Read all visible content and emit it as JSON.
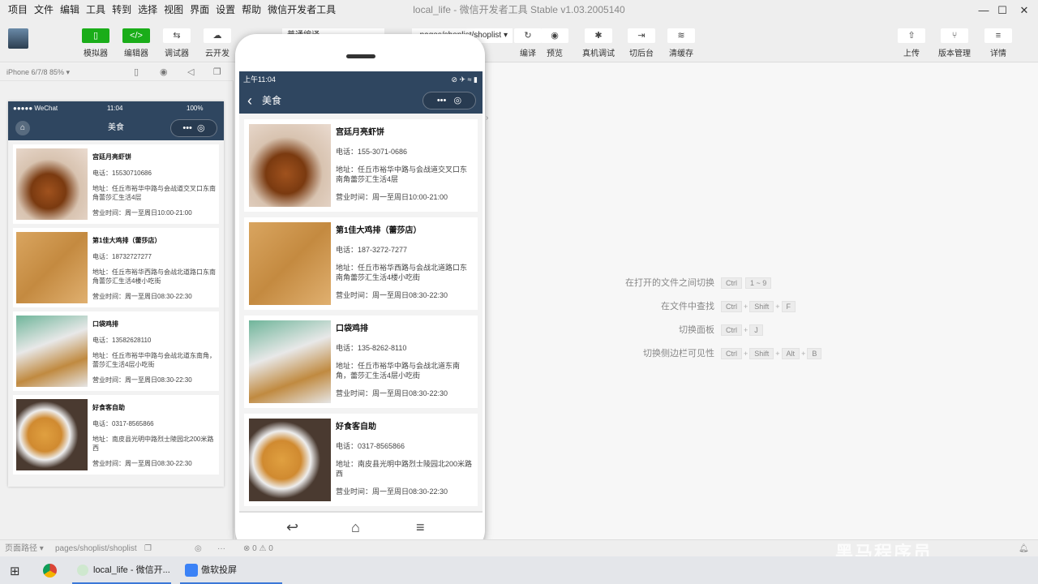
{
  "menubar": {
    "items": [
      "项目",
      "文件",
      "编辑",
      "工具",
      "转到",
      "选择",
      "视图",
      "界面",
      "设置",
      "帮助",
      "微信开发者工具"
    ],
    "window_title": "local_life - 微信开发者工具 Stable v1.03.2005140",
    "minimize": "—",
    "maximize": "☐",
    "close": "✕"
  },
  "toolbar": {
    "left": [
      {
        "label": "模拟器",
        "icon": "▯"
      },
      {
        "label": "编辑器",
        "icon": "</>"
      },
      {
        "label": "调试器",
        "icon": "⇆"
      },
      {
        "label": "云开发",
        "icon": "☁"
      }
    ],
    "compile_mode": "普通编译",
    "page_select": "pages/shoplist/shoplist ▾",
    "mid": [
      {
        "label": "编译",
        "icon": "↻"
      },
      {
        "label": "预览",
        "icon": "◉"
      },
      {
        "label": "真机调试",
        "icon": "✱"
      },
      {
        "label": "切后台",
        "icon": "⇥"
      },
      {
        "label": "清缓存",
        "icon": "≋"
      }
    ],
    "right": [
      {
        "label": "上传",
        "icon": "⇧"
      },
      {
        "label": "版本管理",
        "icon": "⑂"
      },
      {
        "label": "详情",
        "icon": "≡"
      }
    ]
  },
  "simulator": {
    "device": "iPhone 6/7/8 85% ▾",
    "status": {
      "carrier": "●●●●● WeChat",
      "time": "11:04",
      "battery": "100%"
    },
    "nav_title": "美食",
    "shops": [
      {
        "name": "宫廷月亮虾饼",
        "phone": "电话：15530710686",
        "address": "地址：任丘市裕华中路与会战道交叉口东南角蕾莎汇生活4层",
        "hours": "营业时间：周一至周日10:00-21:00"
      },
      {
        "name": "第1佳大鸡排（蕾莎店）",
        "phone": "电话：18732727277",
        "address": "地址：任丘市裕华西路与会战北道路口东南角蕾莎汇生活4楼小吃街",
        "hours": "营业时间：周一至周日08:30-22:30"
      },
      {
        "name": "口袋鸡排",
        "phone": "电话：13582628110",
        "address": "地址：任丘市裕华中路与会战北道东南角，蕾莎汇生活4层小吃街",
        "hours": "营业时间：周一至周日08:30-22:30"
      },
      {
        "name": "好食客自助",
        "phone": "电话：0317-8565866",
        "address": "地址：南皮县光明中路烈士陵园北200米路西",
        "hours": "营业时间：周一至周日08:30-22:30"
      }
    ]
  },
  "device_preview": {
    "status_time": "上午11:04",
    "status_icons": "⊘ ✈ ≈ ▮",
    "nav_title": "美食",
    "back": "‹",
    "shops": [
      {
        "name": "宫廷月亮虾饼",
        "phone": "电话：155-3071-0686",
        "address": "地址：任丘市裕华中路与会战道交叉口东南角蕾莎汇生活4层",
        "hours": "营业时间：周一至周日10:00-21:00"
      },
      {
        "name": "第1佳大鸡排（蕾莎店）",
        "phone": "电话：187-3272-7277",
        "address": "地址：任丘市裕华西路与会战北道路口东南角蕾莎汇生活4楼小吃街",
        "hours": "营业时间：周一至周日08:30-22:30"
      },
      {
        "name": "口袋鸡排",
        "phone": "电话：135-8262-8110",
        "address": "地址：任丘市裕华中路与会战北道东南角，蕾莎汇生活4层小吃街",
        "hours": "营业时间：周一至周日08:30-22:30"
      },
      {
        "name": "好食客自助",
        "phone": "电话：0317-8565866",
        "address": "地址：南皮县光明中路烈士陵园北200米路西",
        "hours": "营业时间：周一至周日08:30-22:30"
      }
    ],
    "nav_back": "↩",
    "nav_home": "⌂",
    "nav_menu": "≡"
  },
  "shortcuts": [
    {
      "label": "在打开的文件之间切换",
      "keys": [
        "Ctrl",
        "1 ~ 9"
      ],
      "sep": ""
    },
    {
      "label": "在文件中查找",
      "keys": [
        "Ctrl",
        "Shift",
        "F"
      ],
      "sep": "+"
    },
    {
      "label": "切换面板",
      "keys": [
        "Ctrl",
        "J"
      ],
      "sep": "+"
    },
    {
      "label": "切换侧边栏可见性",
      "keys": [
        "Ctrl",
        "Shift",
        "Alt",
        "B"
      ],
      "sep": "+"
    }
  ],
  "statusbar": {
    "path_label": "页面路径 ▾",
    "path": "pages/shoplist/shoplist",
    "errors": "⊗ 0 ⚠ 0"
  },
  "taskbar": {
    "apps": [
      "local_life - 微信开...",
      "傲软投屏"
    ]
  },
  "watermark": "黑马程序员"
}
